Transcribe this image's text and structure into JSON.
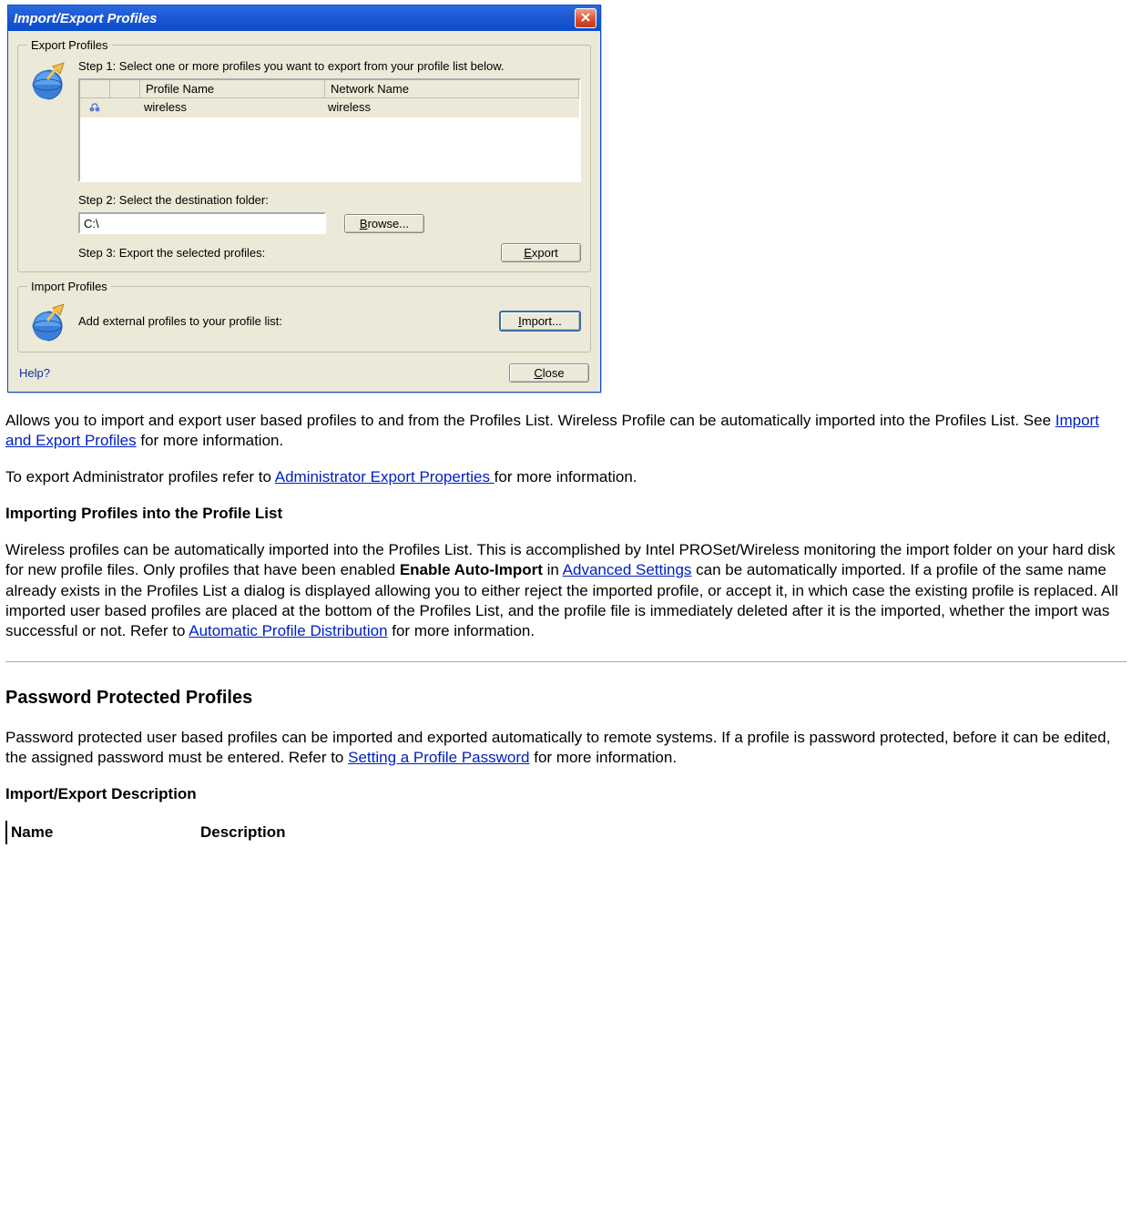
{
  "dialog": {
    "title": "Import/Export Profiles",
    "export": {
      "legend": "Export Profiles",
      "step1": "Step 1: Select one or more profiles you want to export from your profile list below.",
      "table": {
        "headers": {
          "profile": "Profile Name",
          "network": "Network Name"
        },
        "row": {
          "profile": "wireless",
          "network": "wireless"
        }
      },
      "step2": "Step 2: Select the destination folder:",
      "dest_value": "C:\\",
      "browse_pre": "B",
      "browse_rest": "rowse...",
      "step3": "Step 3: Export the selected profiles:",
      "export_pre": "E",
      "export_rest": "xport"
    },
    "import": {
      "legend": "Import Profiles",
      "text": "Add external profiles to your profile list:",
      "import_pre": "I",
      "import_rest": "mport..."
    },
    "help": "Help?",
    "close_pre": "C",
    "close_rest": "lose"
  },
  "doc": {
    "p1a": "Allows you to import and export user based profiles to and from the Profiles List.  Wireless Profile can be automatically imported into the Profiles List. See ",
    "p1_link": "Import and Export Profiles",
    "p1b": " for more information.",
    "p2a": "To export Administrator profiles refer to ",
    "p2_link": "Administrator Export Properties ",
    "p2b": "for more information.",
    "h_import": "Importing Profiles into the Profile List",
    "p3a": "Wireless profiles can be automatically imported into the Profiles List. This is accomplished by Intel PROSet/Wireless monitoring the import folder on your hard disk for new profile files. Only profiles that have been enabled ",
    "p3_bold": "Enable Auto-Import",
    "p3b": " in ",
    "p3_link1": "Advanced Settings",
    "p3c": " can be automatically imported. If a profile of the same name already exists in the Profiles List a dialog is displayed allowing you to either reject the imported profile, or accept it, in which case the existing profile is replaced. All imported user based profiles are placed at the bottom of the Profiles List, and the profile file is immediately deleted after it is the imported, whether the import was successful or not. Refer to ",
    "p3_link2": "Automatic Profile Distribution",
    "p3d": " for more information.",
    "h_password": "Password Protected Profiles",
    "p4a": "Password protected user based profiles can be imported and exported automatically to remote systems. If a profile is password protected, before it can be edited, the assigned password must be entered. Refer to ",
    "p4_link": "Setting a Profile Password",
    "p4b": " for more information.",
    "h_desc": "Import/Export Description",
    "table": {
      "h1": "Name",
      "h2": "Description"
    }
  }
}
